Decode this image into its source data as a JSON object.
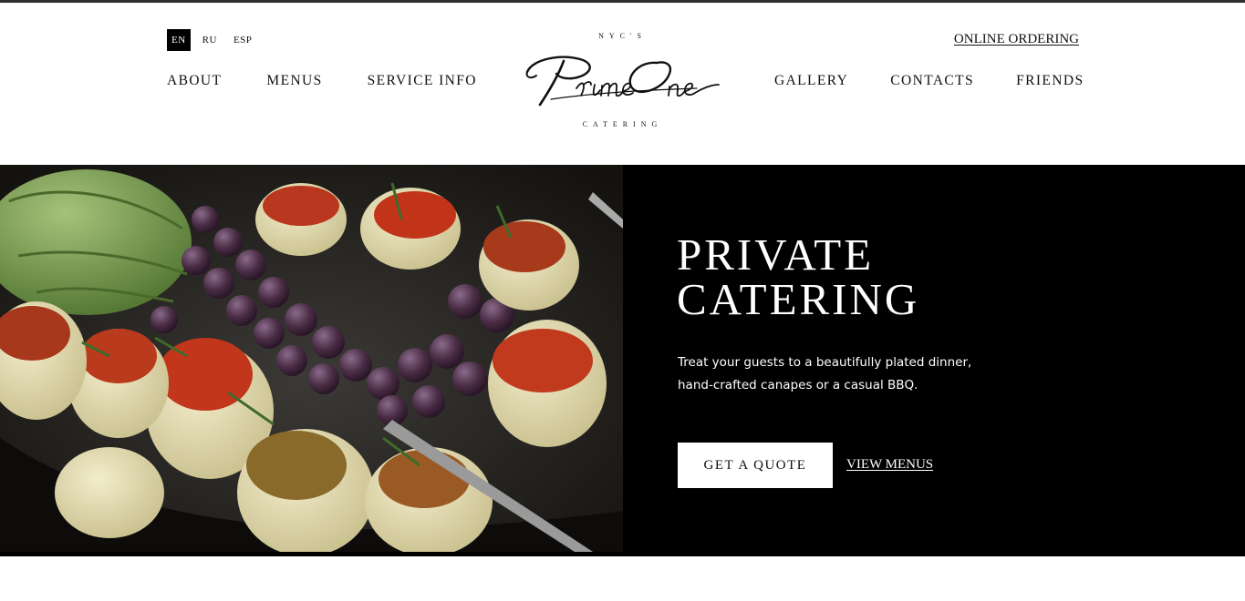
{
  "header": {
    "languages": [
      "EN",
      "RU",
      "ESP"
    ],
    "active_language": "EN",
    "online_ordering": "ONLINE ORDERING",
    "nav_left": [
      "ABOUT",
      "MENUS",
      "SERVICE INFO"
    ],
    "nav_right": [
      "GALLERY",
      "CONTACTS",
      "FRIENDS"
    ],
    "logo": {
      "top_text": "NYC'S",
      "script_text": "Prime One",
      "bottom_text": "CATERING"
    }
  },
  "hero": {
    "title_line1": "PRIVATE",
    "title_line2": "CATERING",
    "description": "Treat your guests to a beautifully plated dinner, hand-crafted canapes or a casual BBQ.",
    "quote_button": "GET A QUOTE",
    "menus_link": "VIEW MENUS",
    "image": "food-photo-stuffed-artichokes-and-grapes"
  },
  "colors": {
    "hero_background": "#000000",
    "top_border": "#2f2f2f",
    "page_background": "#ffffff"
  }
}
